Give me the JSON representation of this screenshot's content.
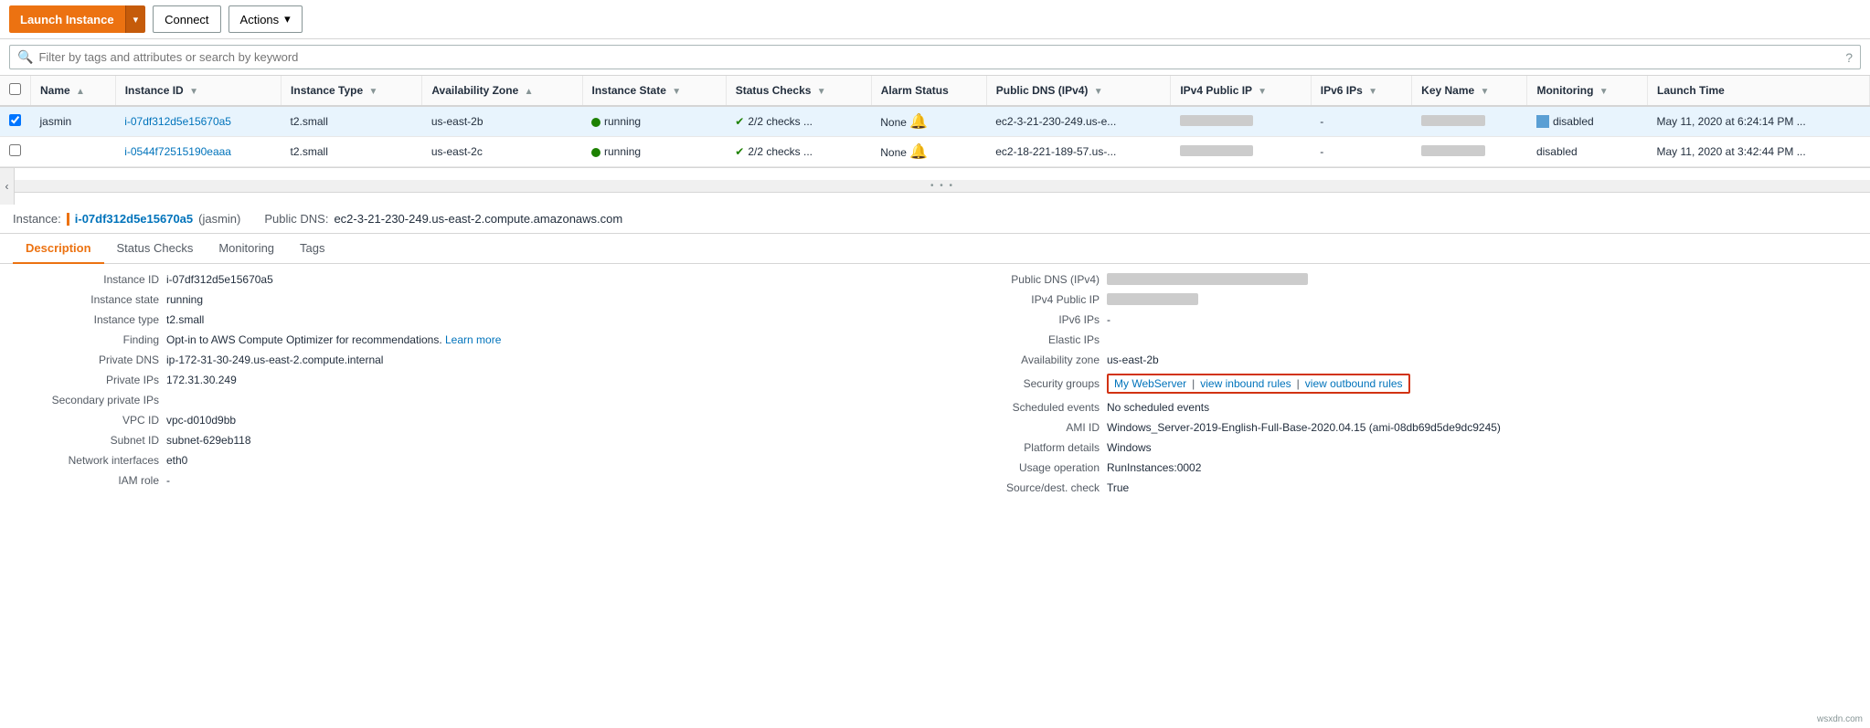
{
  "toolbar": {
    "launch_label": "Launch Instance",
    "connect_label": "Connect",
    "actions_label": "Actions",
    "dropdown_arrow": "▾"
  },
  "search": {
    "placeholder": "Filter by tags and attributes or search by keyword",
    "help_icon": "?"
  },
  "table": {
    "columns": [
      {
        "id": "name",
        "label": "Name",
        "sortable": true
      },
      {
        "id": "instance_id",
        "label": "Instance ID",
        "sortable": true
      },
      {
        "id": "instance_type",
        "label": "Instance Type",
        "sortable": true
      },
      {
        "id": "availability_zone",
        "label": "Availability Zone",
        "sortable": true
      },
      {
        "id": "instance_state",
        "label": "Instance State",
        "sortable": true
      },
      {
        "id": "status_checks",
        "label": "Status Checks",
        "sortable": true
      },
      {
        "id": "alarm_status",
        "label": "Alarm Status",
        "sortable": false
      },
      {
        "id": "public_dns",
        "label": "Public DNS (IPv4)",
        "sortable": true
      },
      {
        "id": "ipv4_public",
        "label": "IPv4 Public IP",
        "sortable": true
      },
      {
        "id": "ipv6_ips",
        "label": "IPv6 IPs",
        "sortable": true
      },
      {
        "id": "key_name",
        "label": "Key Name",
        "sortable": true
      },
      {
        "id": "monitoring",
        "label": "Monitoring",
        "sortable": true
      },
      {
        "id": "launch_time",
        "label": "Launch Time",
        "sortable": true
      }
    ],
    "rows": [
      {
        "selected": true,
        "name": "jasmin",
        "instance_id": "i-07df312d5e15670a5",
        "instance_type": "t2.small",
        "availability_zone": "us-east-2b",
        "instance_state": "running",
        "status_checks": "2/2 checks ...",
        "alarm_status": "None",
        "public_dns": "ec2-3-21-230-249.us-e...",
        "ipv4_public": "blurred",
        "ipv6_ips": "-",
        "key_name": "blurred",
        "monitoring": "disabled",
        "launch_time": "May 11, 2020 at 6:24:14 PM ..."
      },
      {
        "selected": false,
        "name": "",
        "instance_id": "i-0544f72515190eaaa",
        "instance_type": "t2.small",
        "availability_zone": "us-east-2c",
        "instance_state": "running",
        "status_checks": "2/2 checks ...",
        "alarm_status": "None",
        "public_dns": "ec2-18-221-189-57.us-...",
        "ipv4_public": "blurred",
        "ipv6_ips": "-",
        "key_name": "blurred",
        "monitoring": "disabled",
        "launch_time": "May 11, 2020 at 3:42:44 PM ..."
      }
    ]
  },
  "instance_banner": {
    "label": "Instance:",
    "instance_id": "i-07df312d5e15670a5",
    "instance_name": "(jasmin)",
    "public_dns_label": "Public DNS:",
    "public_dns": "ec2-3-21-230-249.us-east-2.compute.amazonaws.com"
  },
  "tabs": [
    {
      "label": "Description",
      "active": true
    },
    {
      "label": "Status Checks",
      "active": false
    },
    {
      "label": "Monitoring",
      "active": false
    },
    {
      "label": "Tags",
      "active": false
    }
  ],
  "detail_left": {
    "rows": [
      {
        "label": "Instance ID",
        "value": "i-07df312d5e15670a5",
        "type": "text"
      },
      {
        "label": "Instance state",
        "value": "running",
        "type": "text"
      },
      {
        "label": "Instance type",
        "value": "t2.small",
        "type": "text"
      },
      {
        "label": "Finding",
        "value": "Opt-in to AWS Compute Optimizer for recommendations.",
        "link": "Learn more",
        "type": "link"
      },
      {
        "label": "Private DNS",
        "value": "ip-172-31-30-249.us-east-2.compute.internal",
        "type": "text"
      },
      {
        "label": "Private IPs",
        "value": "172.31.30.249",
        "type": "text"
      },
      {
        "label": "Secondary private IPs",
        "value": "",
        "type": "text"
      },
      {
        "label": "VPC ID",
        "value": "vpc-d010d9bb",
        "type": "linkblue"
      },
      {
        "label": "Subnet ID",
        "value": "subnet-629eb118",
        "type": "linkblue"
      },
      {
        "label": "Network interfaces",
        "value": "eth0",
        "type": "linkblue"
      },
      {
        "label": "IAM role",
        "value": "-",
        "type": "text"
      }
    ]
  },
  "detail_right": {
    "rows": [
      {
        "label": "Public DNS (IPv4)",
        "value": "blurred_long",
        "type": "blurred"
      },
      {
        "label": "IPv4 Public IP",
        "value": "blurred_short",
        "type": "blurred"
      },
      {
        "label": "IPv6 IPs",
        "value": "-",
        "type": "text"
      },
      {
        "label": "Elastic IPs",
        "value": "",
        "type": "text"
      },
      {
        "label": "Availability zone",
        "value": "us-east-2b",
        "type": "text"
      },
      {
        "label": "Security groups",
        "value": "My WebServer",
        "link_inbound": "view inbound rules",
        "link_outbound": "view outbound rules",
        "type": "security"
      },
      {
        "label": "Scheduled events",
        "value": "No scheduled events",
        "type": "linkblue"
      },
      {
        "label": "AMI ID",
        "value": "Windows_Server-2019-English-Full-Base-2020.04.15 (ami-08db69d5de9dc9245)",
        "type": "linkblue"
      },
      {
        "label": "Platform details",
        "value": "Windows",
        "type": "text"
      },
      {
        "label": "Usage operation",
        "value": "RunInstances:0002",
        "type": "text"
      },
      {
        "label": "Source/dest. check",
        "value": "True",
        "type": "text"
      }
    ]
  },
  "watermark": "wsxdn.com"
}
